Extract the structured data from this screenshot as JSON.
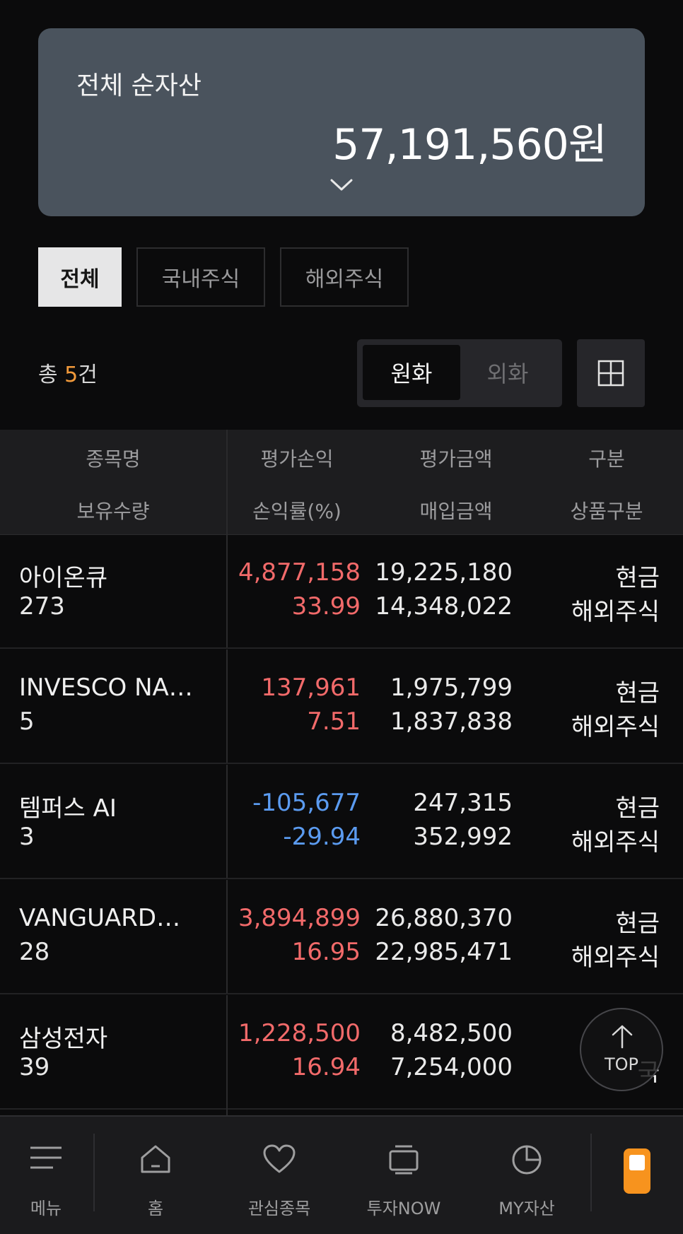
{
  "summary": {
    "title": "전체 순자산",
    "amount": "57,191,560원"
  },
  "filters": [
    "전체",
    "국내주식",
    "해외주식"
  ],
  "count": {
    "prefix": "총 ",
    "num": "5",
    "suffix": "건"
  },
  "currency_toggle": {
    "selected": "원화",
    "other": "외화"
  },
  "table_headers": {
    "row1": [
      "종목명",
      "평가손익",
      "평가금액",
      "구분"
    ],
    "row2": [
      "보유수량",
      "손익률(%)",
      "매입금액",
      "상품구분"
    ]
  },
  "holdings": [
    {
      "name": "아이온큐",
      "qty": "273",
      "pl": "4,877,158",
      "rate": "33.99",
      "value": "19,225,180",
      "cost": "14,348,022",
      "type": "현금",
      "category": "해외주식",
      "trend": "up"
    },
    {
      "name": "INVESCO NA…",
      "qty": "5",
      "pl": "137,961",
      "rate": "7.51",
      "value": "1,975,799",
      "cost": "1,837,838",
      "type": "현금",
      "category": "해외주식",
      "trend": "up"
    },
    {
      "name": "템퍼스 AI",
      "qty": "3",
      "pl": "-105,677",
      "rate": "-29.94",
      "value": "247,315",
      "cost": "352,992",
      "type": "현금",
      "category": "해외주식",
      "trend": "down"
    },
    {
      "name": "VANGUARD…",
      "qty": "28",
      "pl": "3,894,899",
      "rate": "16.95",
      "value": "26,880,370",
      "cost": "22,985,471",
      "type": "현금",
      "category": "해외주식",
      "trend": "up"
    },
    {
      "name": "삼성전자",
      "qty": "39",
      "pl": "1,228,500",
      "rate": "16.94",
      "value": "8,482,500",
      "cost": "7,254,000",
      "type": "",
      "category": "국",
      "trend": "up"
    }
  ],
  "top_button": "TOP",
  "bottom_nav": [
    "메뉴",
    "홈",
    "관심종목",
    "투자NOW",
    "MY자산"
  ],
  "colors": {
    "up": "#f26a6a",
    "down": "#5b9bf0",
    "accent": "#f29a3b",
    "app_icon": "#f7931e"
  }
}
